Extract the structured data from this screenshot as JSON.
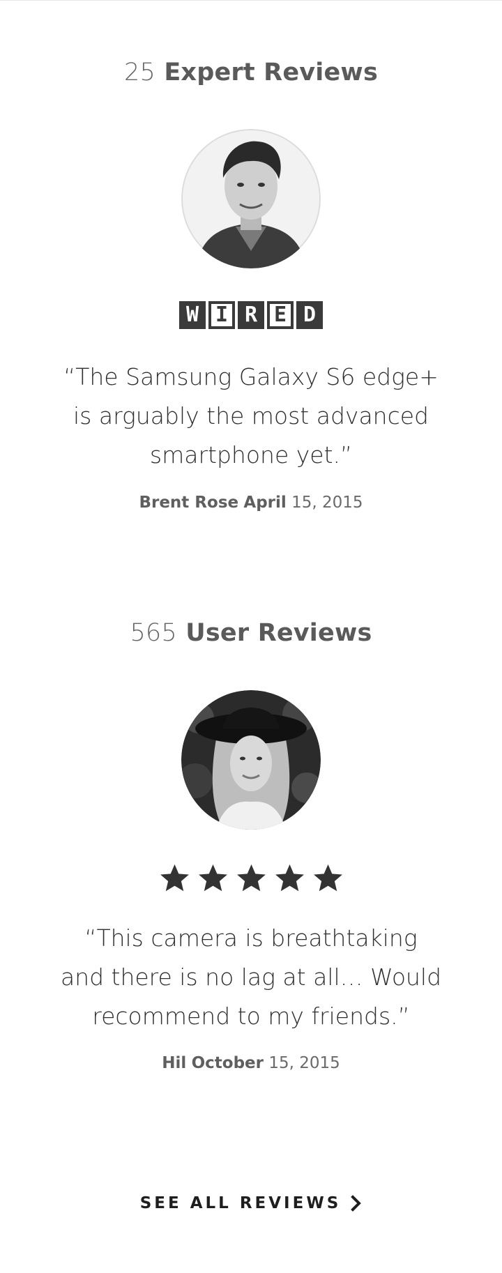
{
  "expert": {
    "count": "25",
    "label": "Expert Reviews",
    "publication": "WIRED",
    "publication_letters": [
      "W",
      "I",
      "R",
      "E",
      "D"
    ],
    "quote_lines": [
      "“The Samsung Galaxy S6 edge+",
      "is arguably the most advanced",
      "smartphone yet.”"
    ],
    "author": "Brent Rose",
    "date_month": "April",
    "date_rest": "15, 2015"
  },
  "user": {
    "count": "565",
    "label": "User Reviews",
    "rating": 5,
    "rating_max": 5,
    "quote_lines": [
      "“This camera is breathtaking",
      "and there is no lag at all… Would",
      "recommend to my friends.”"
    ],
    "author": "Hil",
    "date_month": "October",
    "date_rest": "15, 2015"
  },
  "cta": {
    "label": "SEE ALL REVIEWS",
    "icon": "chevron-right-icon"
  },
  "colors": {
    "text_dark": "#2f2f2f",
    "text_gray": "#5a5a5a",
    "logo": "#3a3a3a",
    "star": "#333333"
  }
}
